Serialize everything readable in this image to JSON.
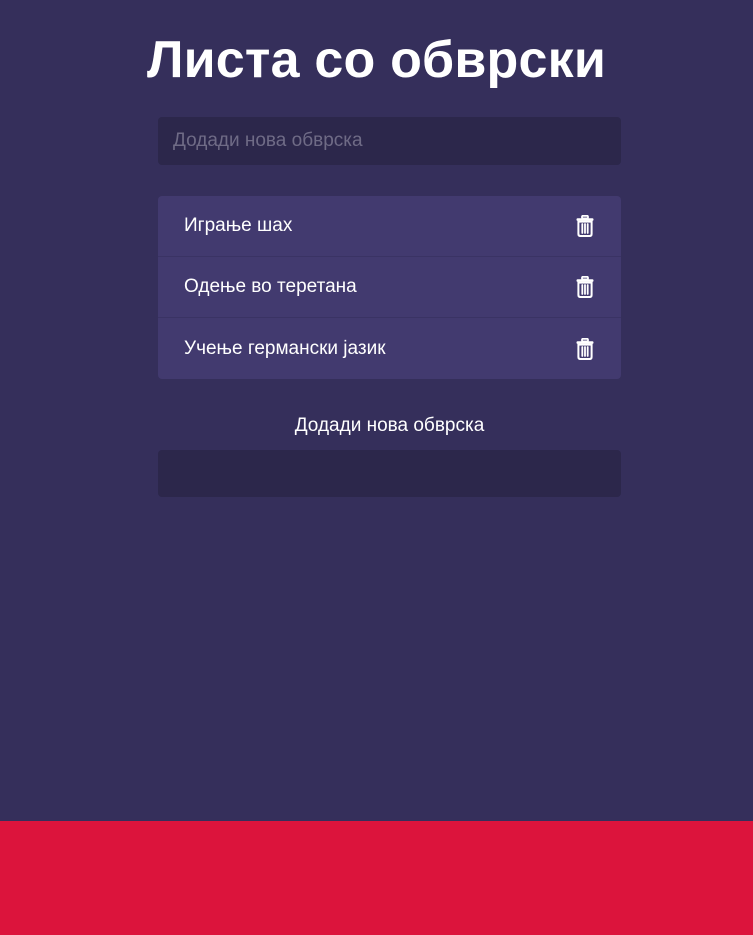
{
  "title": "Листа со обврски",
  "new_task": {
    "placeholder": "Додади нова обврска",
    "value": ""
  },
  "tasks": [
    {
      "label": "Играње шах",
      "icon": "trash-icon"
    },
    {
      "label": "Одење во теретана",
      "icon": "trash-icon"
    },
    {
      "label": "Учење германски јазик",
      "icon": "trash-icon"
    }
  ],
  "footer_form": {
    "label": "Додади нова обврска",
    "value": ""
  },
  "colors": {
    "background": "#352f5b",
    "input_background": "#2c274b",
    "task_background": "#423a6f",
    "bottom_band": "#dc143c",
    "text": "#ffffff"
  }
}
